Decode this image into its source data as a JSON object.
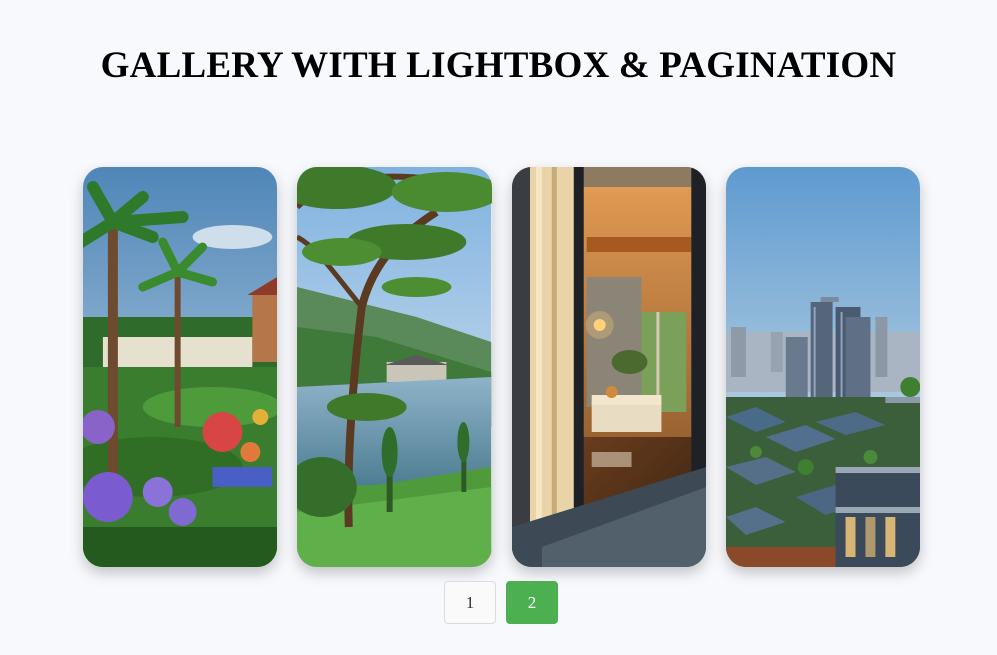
{
  "title": "GALLERY WITH LIGHTBOX & PAGINATION",
  "gallery": {
    "images": [
      {
        "subject": "tropical garden with palm trees and flowers"
      },
      {
        "subject": "tree overlooking lake and hills"
      },
      {
        "subject": "warm interior seen through open glass door"
      },
      {
        "subject": "modern city skyline with townhouses"
      }
    ]
  },
  "pagination": {
    "pages": [
      "1",
      "2"
    ],
    "current": "2",
    "active_color": "#4caf50"
  }
}
